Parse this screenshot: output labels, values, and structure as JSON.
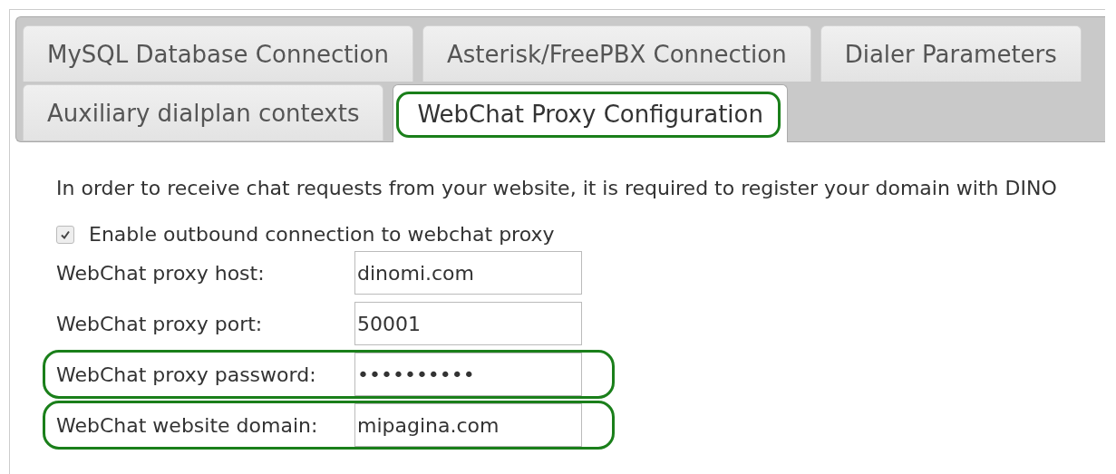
{
  "tab_rows": [
    [
      {
        "label": "MySQL Database Connection",
        "selected": false,
        "highlighted": false
      },
      {
        "label": "Asterisk/FreePBX Connection",
        "selected": false,
        "highlighted": false
      },
      {
        "label": "Dialer Parameters",
        "selected": false,
        "highlighted": false
      }
    ],
    [
      {
        "label": "Auxiliary dialplan contexts",
        "selected": false,
        "highlighted": false
      },
      {
        "label": "WebChat Proxy Configuration",
        "selected": true,
        "highlighted": true
      }
    ]
  ],
  "intro": "In order to receive chat requests from your website, it is required to register your domain with DINO",
  "enable_checkbox": {
    "label": "Enable outbound connection to webchat proxy",
    "checked": true
  },
  "fields": [
    {
      "label": "WebChat proxy host:",
      "value": "dinomi.com",
      "highlighted": false
    },
    {
      "label": "WebChat proxy port:",
      "value": "50001",
      "highlighted": false
    },
    {
      "label": "WebChat proxy password:",
      "value": "••••••••••",
      "highlighted": true
    },
    {
      "label": "WebChat website domain:",
      "value": "mipagina.com",
      "highlighted": true
    }
  ]
}
